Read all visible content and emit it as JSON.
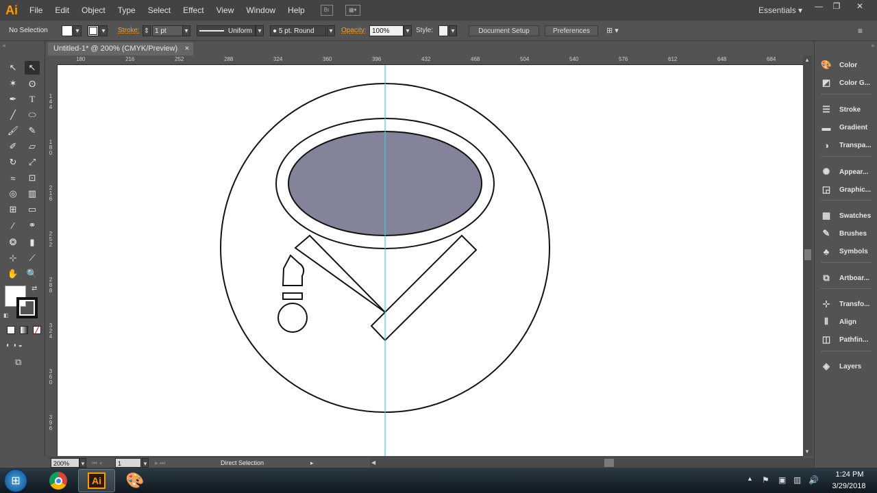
{
  "app": {
    "logo": "Ai"
  },
  "menu": [
    "File",
    "Edit",
    "Object",
    "Type",
    "Select",
    "Effect",
    "View",
    "Window",
    "Help"
  ],
  "menubar_icons": {
    "bridge": "Br"
  },
  "workspace": {
    "label": "Essentials"
  },
  "control": {
    "selection": "No Selection",
    "stroke_label": "Stroke:",
    "stroke_value": "1 pt",
    "profile": "Uniform",
    "brush": "5 pt. Round",
    "opacity_label": "Opacity:",
    "opacity_value": "100%",
    "style_label": "Style:",
    "doc_setup": "Document Setup",
    "preferences": "Preferences"
  },
  "document_tab": {
    "title": "Untitled-1* @ 200% (CMYK/Preview)",
    "close": "×"
  },
  "ruler": {
    "h_labels": [
      "180",
      "216",
      "252",
      "288",
      "324",
      "360",
      "396",
      "432",
      "468",
      "504",
      "540",
      "576",
      "612",
      "648",
      "684",
      "720"
    ],
    "v_labels": [
      "144",
      "180",
      "216",
      "252",
      "288",
      "324",
      "360",
      "396"
    ]
  },
  "status": {
    "zoom": "200%",
    "artboard": "1",
    "tool": "Direct Selection"
  },
  "panels": [
    {
      "label": "Color",
      "icon": "palette-icon"
    },
    {
      "label": "Color G...",
      "icon": "color-guide-icon"
    },
    {
      "label": "Stroke",
      "icon": "stroke-icon"
    },
    {
      "label": "Gradient",
      "icon": "gradient-icon"
    },
    {
      "label": "Transpa...",
      "icon": "transparency-icon"
    },
    {
      "label": "Appear...",
      "icon": "appearance-icon"
    },
    {
      "label": "Graphic...",
      "icon": "graphic-styles-icon"
    },
    {
      "label": "Swatches",
      "icon": "swatches-icon"
    },
    {
      "label": "Brushes",
      "icon": "brushes-icon"
    },
    {
      "label": "Symbols",
      "icon": "symbols-icon"
    },
    {
      "label": "Artboar...",
      "icon": "artboards-icon"
    },
    {
      "label": "Transfo...",
      "icon": "transform-icon"
    },
    {
      "label": "Align",
      "icon": "align-icon"
    },
    {
      "label": "Pathfin...",
      "icon": "pathfinder-icon"
    },
    {
      "label": "Layers",
      "icon": "layers-icon"
    }
  ],
  "colors": {
    "ellipse_fill": "#83839a",
    "guide": "#3fd0d8"
  },
  "taskbar": {
    "time": "1:24 PM",
    "date": "3/29/2018",
    "ai_label": "Ai"
  }
}
